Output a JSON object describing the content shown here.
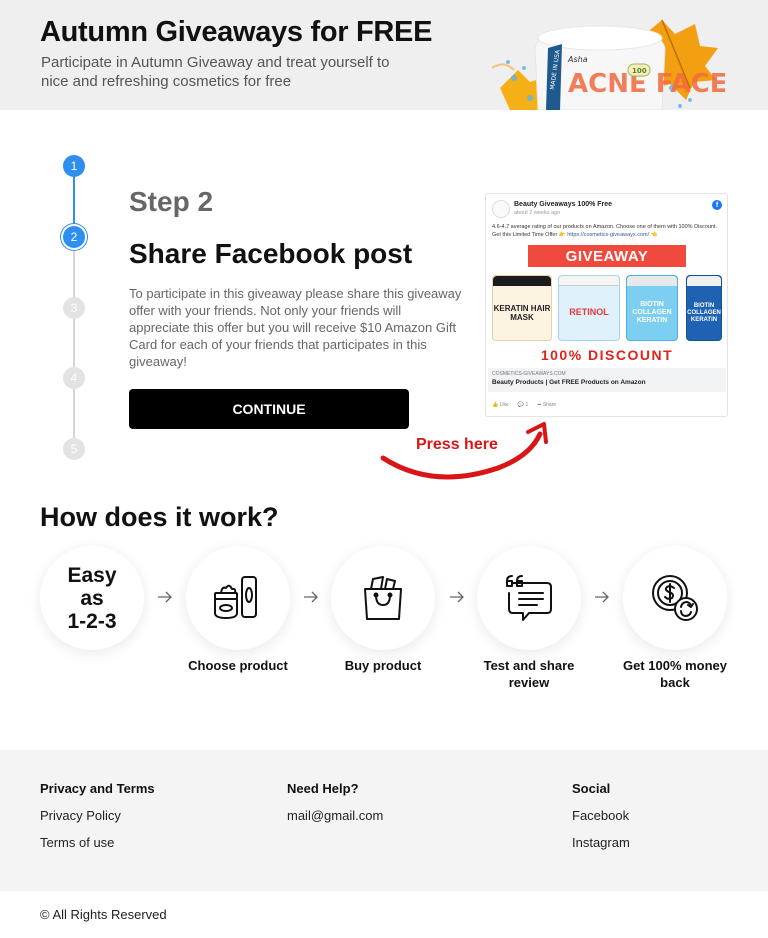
{
  "hero": {
    "title": "Autumn Giveaways for FREE",
    "subtitle": "Participate in Autumn Giveaway and treat yourself to nice and refreshing cosmetics for free",
    "product_text": "ACNE FACE",
    "product_side": "MADE IN USA",
    "product_brand": "Asha",
    "product_badge": "100"
  },
  "stepper": {
    "steps": [
      "1",
      "2",
      "3",
      "4",
      "5"
    ],
    "active": 2
  },
  "step": {
    "label": "Step 2",
    "title": "Share Facebook post",
    "description": "To participate in this giveaway please share this giveaway offer with your friends. Not only your friends will appreciate this offer but you will receive $10 Amazon Gift Card for each of your friends that participates in this giveaway!",
    "button_label": "CONTINUE"
  },
  "fb_post": {
    "page_name": "Beauty Giveaways 100% Free",
    "time": "about 2 weeks ago",
    "text": "4.6-4.7 average rating of our products on Amazon. Choose one of them with 100% Discount. Get this Limited Time Offer 👉 ",
    "link": "https://cosmetics-giveaways.com/",
    "link_suffix": " 👈",
    "banner": "GIVEAWAY",
    "products": [
      "KERATIN HAIR MASK",
      "RETINOL",
      "BIOTIN COLLAGEN KERATIN",
      "BIOTIN COLLAGEN KERATIN"
    ],
    "discount": "100% DISCOUNT",
    "domain": "COSMETICS-GIVEAWAYS.COM",
    "headline": "Beauty Products | Get FREE Products on Amazon",
    "actions": [
      "Like",
      "1",
      "Share"
    ]
  },
  "press_here": "Press here",
  "how": {
    "title": "How does it work?",
    "easy": [
      "Easy",
      "as",
      "1-2-3"
    ],
    "steps": [
      {
        "label": "Choose product",
        "icon": "cosmetics-icon"
      },
      {
        "label": "Buy product",
        "icon": "shopping-bag-icon"
      },
      {
        "label": "Test and share review",
        "icon": "review-icon"
      },
      {
        "label": "Get 100% money back",
        "icon": "money-back-icon"
      }
    ]
  },
  "footer": {
    "columns": [
      {
        "heading": "Privacy and Terms",
        "links": [
          "Privacy Policy",
          "Terms of use"
        ]
      },
      {
        "heading": "Need Help?",
        "links": [
          "mail@gmail.com"
        ]
      },
      {
        "heading": "Social",
        "links": [
          "Facebook",
          "Instagram"
        ]
      }
    ],
    "copyright": "© All Rights Reserved"
  },
  "colors": {
    "accent": "#2d8ff0",
    "button": "#000000",
    "press_here": "#d91515",
    "giveaway_banner": "#f0493e"
  }
}
